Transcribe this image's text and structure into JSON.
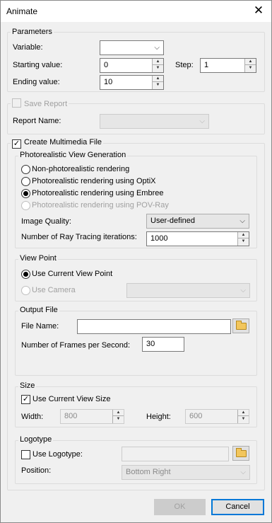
{
  "window": {
    "title": "Animate",
    "close_symbol": "✕"
  },
  "parameters": {
    "legend": "Parameters",
    "variable_label": "Variable:",
    "variable_value": "",
    "starting_label": "Starting value:",
    "starting_value": "0",
    "step_label": "Step:",
    "step_value": "1",
    "ending_label": "Ending value:",
    "ending_value": "10"
  },
  "report": {
    "save_label": "Save Report",
    "save_checked": false,
    "name_label": "Report Name:",
    "name_value": ""
  },
  "multimedia": {
    "create_label": "Create Multimedia File",
    "create_checked": true,
    "photo": {
      "legend": "Photorealistic View Generation",
      "options": [
        "Non-photorealistic rendering",
        "Photorealistic rendering using OptiX",
        "Photorealistic rendering using Embree",
        "Photorealistic rendering using POV-Ray"
      ],
      "quality_label": "Image Quality:",
      "quality_value": "User-defined",
      "rays_label": "Number of Ray Tracing iterations:",
      "rays_value": "1000"
    },
    "viewpoint": {
      "legend": "View Point",
      "current_label": "Use Current View Point",
      "camera_label": "Use Camera",
      "camera_value": ""
    },
    "output": {
      "legend": "Output File",
      "file_label": "File Name:",
      "file_value": "",
      "fps_label": "Number of Frames per Second:",
      "fps_value": "30"
    },
    "size": {
      "legend": "Size",
      "current_label": "Use Current View Size",
      "width_label": "Width:",
      "width_value": "800",
      "height_label": "Height:",
      "height_value": "600"
    },
    "logotype": {
      "legend": "Logotype",
      "use_label": "Use Logotype:",
      "logo_value": "",
      "position_label": "Position:",
      "position_value": "Bottom Right"
    }
  },
  "buttons": {
    "ok": "OK",
    "cancel": "Cancel"
  },
  "icons": {
    "chevron": "⌵",
    "spin_up": "▲",
    "spin_down": "▼",
    "check": "✓"
  }
}
